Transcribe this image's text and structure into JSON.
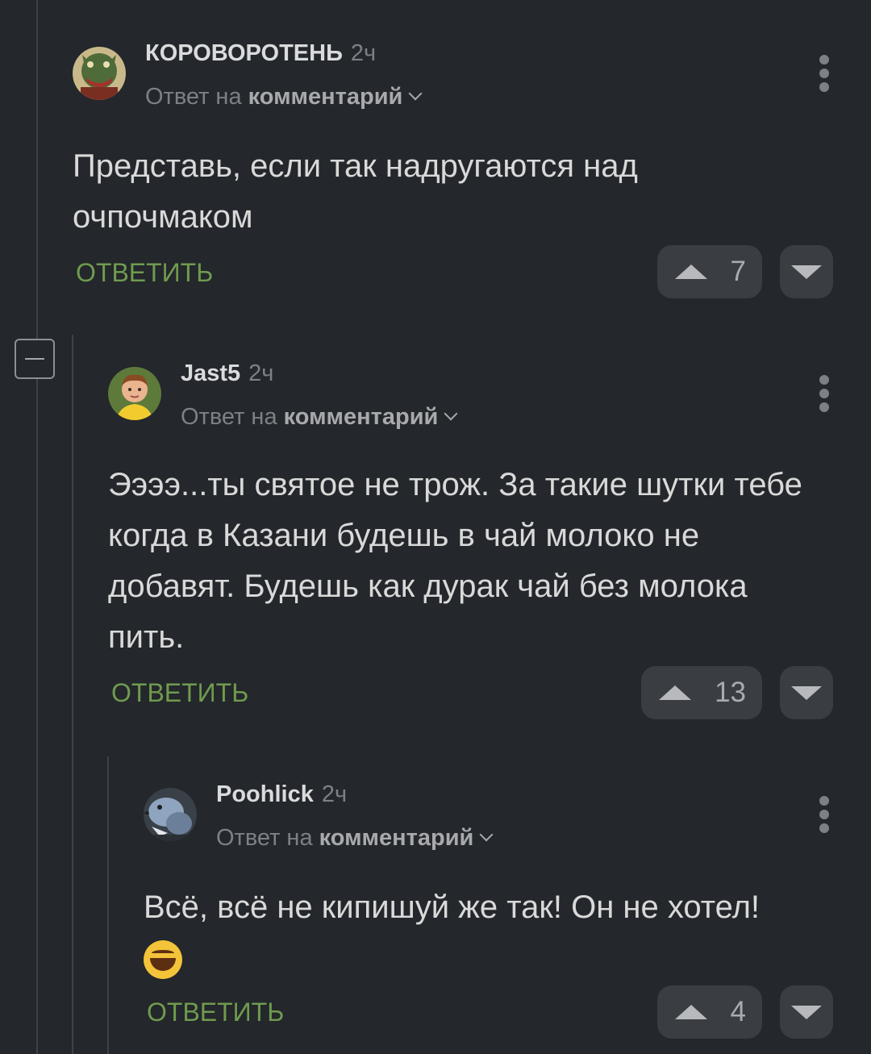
{
  "comments": [
    {
      "author": "КОРОВОРОТЕНЬ",
      "time": "2ч",
      "reply_prefix": "Ответ на",
      "reply_link": "комментарий",
      "text": "Представь, если так надругаются над очпочмаком",
      "reply_label": "ОТВЕТИТЬ",
      "rating": "7",
      "avatar": "avatar-monster-icon"
    },
    {
      "author": "Jast5",
      "time": "2ч",
      "reply_prefix": "Ответ на",
      "reply_link": "комментарий",
      "text": "Ээээ...ты святое не трож. За такие шутки тебе когда в Казани будешь в чай молоко не добавят. Будешь как дурак чай без молока пить.",
      "reply_label": "ОТВЕТИТЬ",
      "rating": "13",
      "avatar": "avatar-boy-icon"
    },
    {
      "author": "Poohlick",
      "time": "2ч",
      "reply_prefix": "Ответ на",
      "reply_link": "комментарий",
      "text": "Всё, всё не кипишуй же так! Он не хотел!",
      "emoji": "face-with-tears-of-joy",
      "reply_label": "ОТВЕТИТЬ",
      "rating": "4",
      "avatar": "avatar-pigeon-icon"
    }
  ],
  "colors": {
    "background": "#24272b",
    "reply_green": "#6f9b4f",
    "vote_bg": "#3a3d42"
  }
}
